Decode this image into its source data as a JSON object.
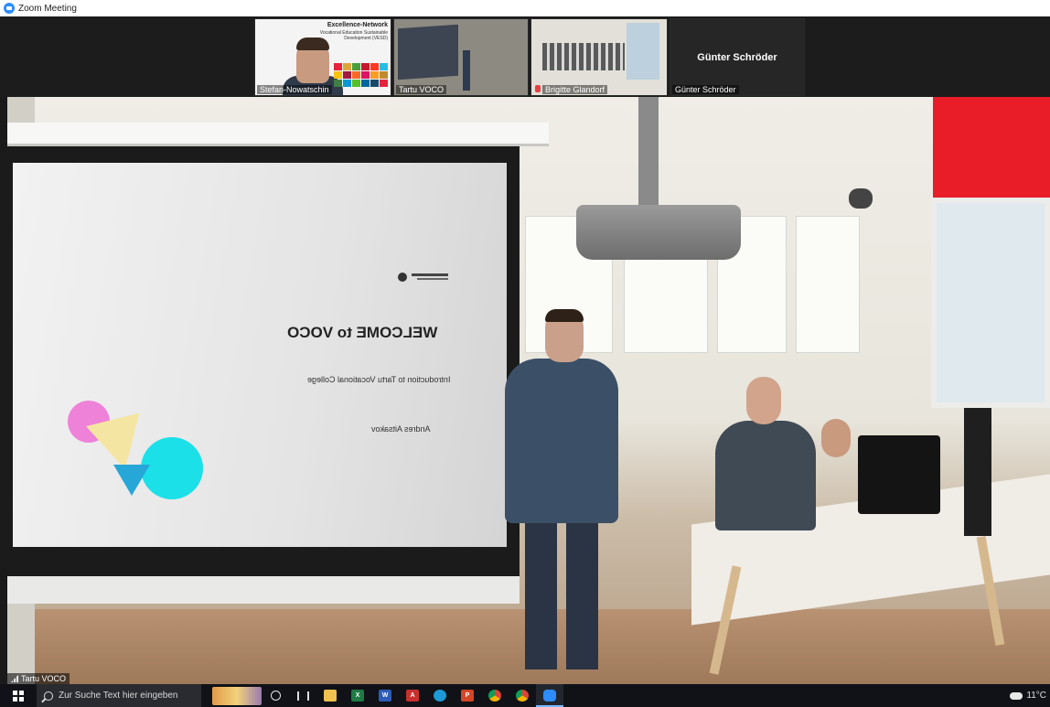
{
  "window": {
    "title": "Zoom Meeting"
  },
  "gallery": [
    {
      "name": "Stefan-Nowatschin",
      "slide_title": "Excellence-Network",
      "slide_subtitle": "Vocational Education Sustainable Development (VESD)"
    },
    {
      "name": "Tartu VOCO"
    },
    {
      "name": "Brigitte Glandorf"
    },
    {
      "name": "Günter Schröder",
      "display_name": "Günter Schröder"
    }
  ],
  "main_video": {
    "name": "Tartu VOCO",
    "slide": {
      "heading": "WELCOME to VOCO",
      "subtitle": "Introduction to Tartu Vocational College",
      "author": "Andres Aitsakov"
    }
  },
  "taskbar": {
    "search_placeholder": "Zur Suche Text hier eingeben",
    "apps": [
      "cortana",
      "task-view",
      "file-explorer",
      "excel",
      "word",
      "acrobat",
      "edge",
      "powerpoint",
      "chrome",
      "chrome",
      "zoom"
    ],
    "weather_temp": "11°C"
  },
  "colors": {
    "zoom_blue": "#2d8cff",
    "slide_pink": "#ee82d8",
    "slide_cyan": "#1ce0e8",
    "slide_yellow": "#f4e6a2",
    "blind_red": "#e81d28"
  }
}
